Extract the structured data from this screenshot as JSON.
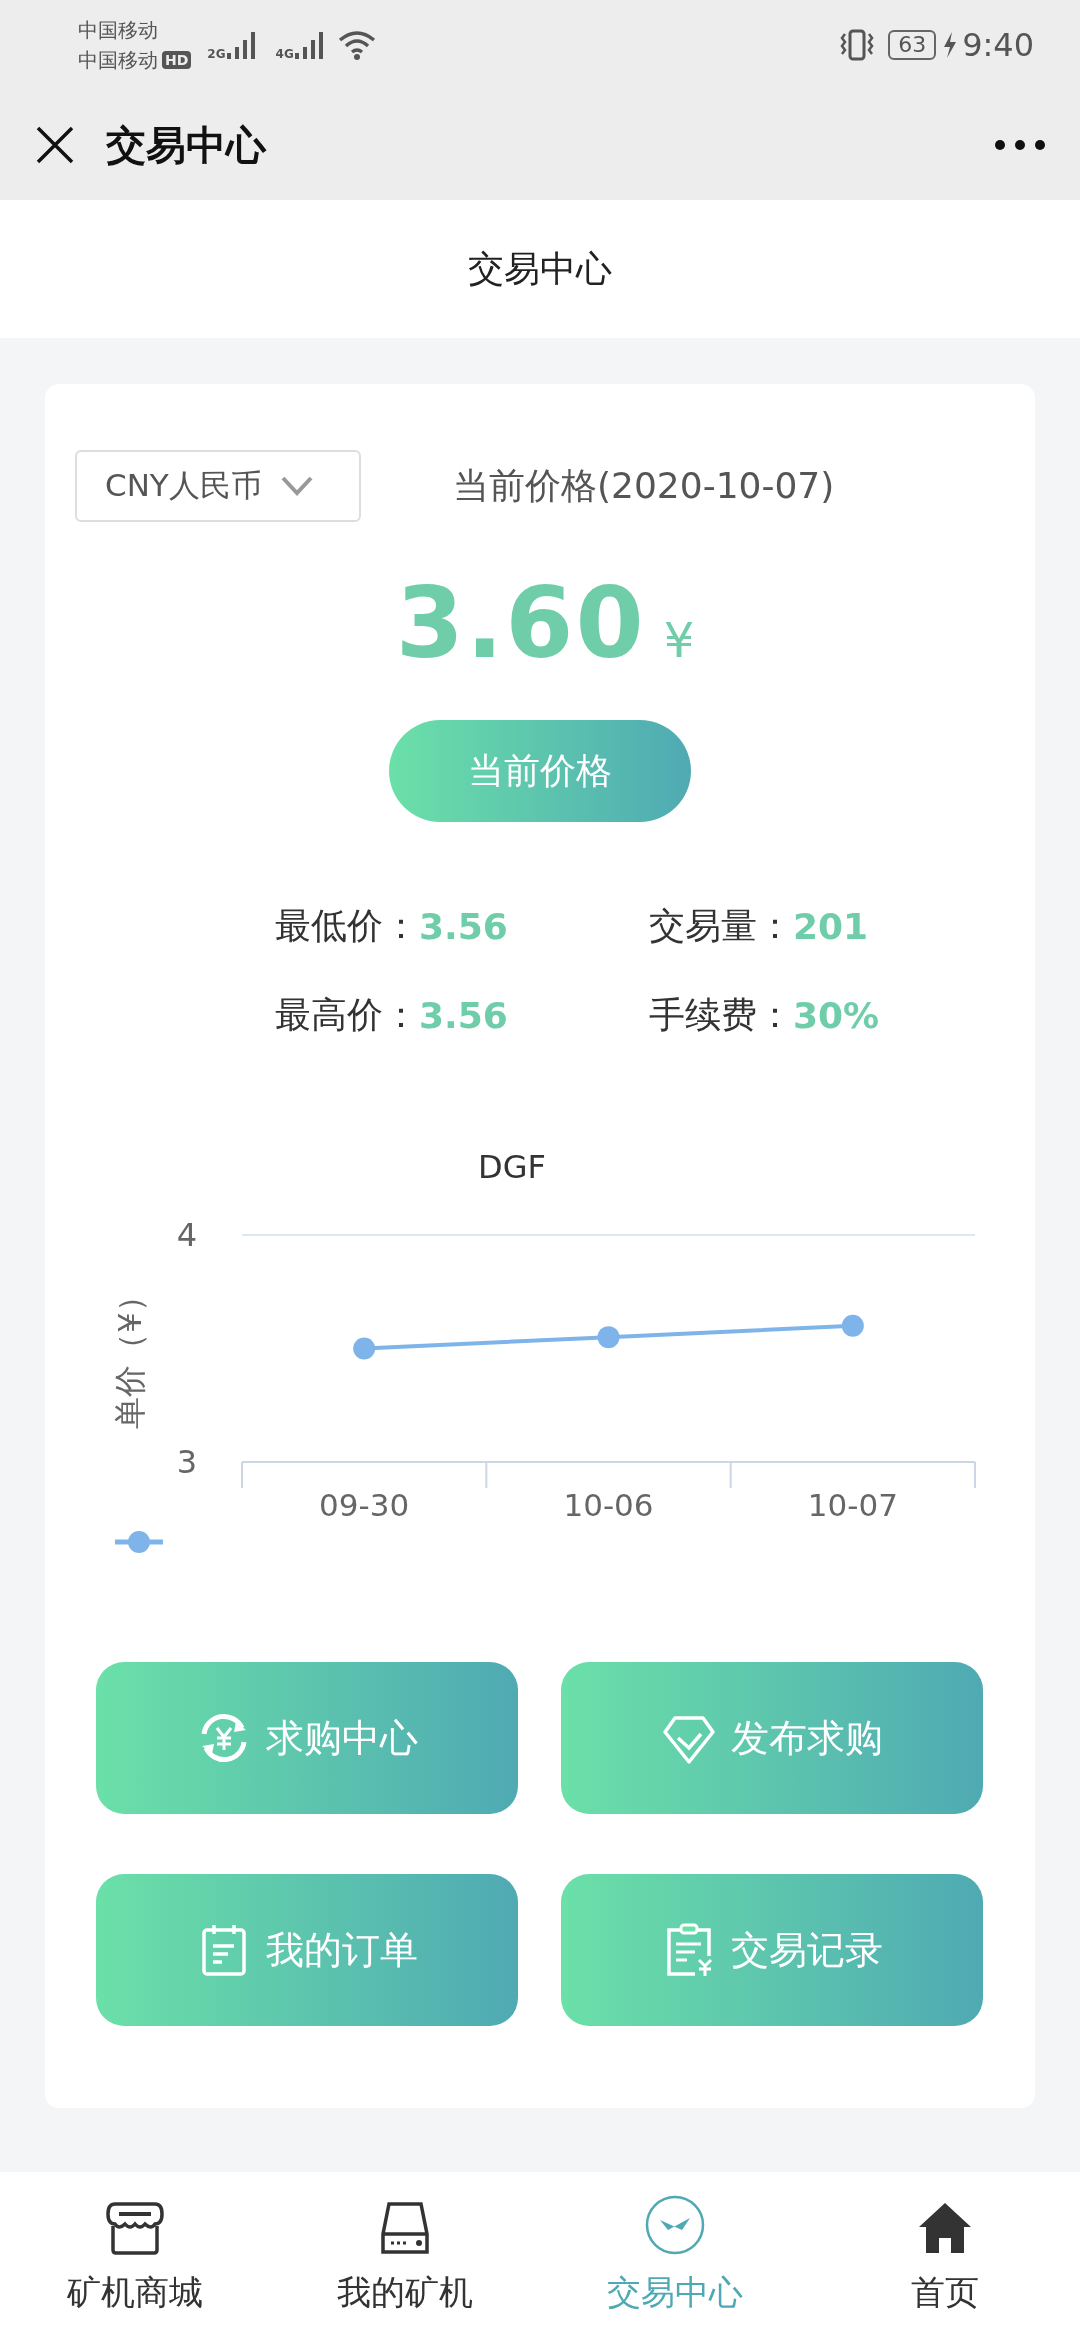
{
  "status_bar": {
    "carriers": [
      {
        "name": "中国移动"
      },
      {
        "name": "中国移动",
        "badge": "HD"
      }
    ],
    "networks": [
      "2G",
      "4G"
    ],
    "battery": "63",
    "time": "9:40"
  },
  "nav_bar": {
    "title": "交易中心"
  },
  "page_title": "交易中心",
  "currency_select": {
    "value": "CNY人民币"
  },
  "price_date": "当前价格(2020-10-07)",
  "price": {
    "value": "3.60",
    "unit": "¥"
  },
  "price_button": "当前价格",
  "stats": [
    {
      "label": "最低价：",
      "value": "3.56"
    },
    {
      "label": "交易量：",
      "value": "201"
    },
    {
      "label": "最高价：",
      "value": "3.56"
    },
    {
      "label": "手续费：",
      "value": "30%"
    }
  ],
  "chart_data": {
    "type": "line",
    "title": "DGF",
    "ylabel": "单价（¥）",
    "categories": [
      "09-30",
      "10-06",
      "10-07"
    ],
    "series": [
      {
        "color": "#7eb4ea",
        "marker": "circle",
        "values": [
          3.5,
          3.55,
          3.6
        ]
      }
    ],
    "ylim": [
      3,
      4
    ],
    "yticks": [
      3,
      4
    ]
  },
  "actions": [
    {
      "label": "求购中心"
    },
    {
      "label": "发布求购"
    },
    {
      "label": "我的订单"
    },
    {
      "label": "交易记录"
    }
  ],
  "tabs": [
    {
      "label": "矿机商城",
      "selected": false
    },
    {
      "label": "我的矿机",
      "selected": false
    },
    {
      "label": "交易中心",
      "selected": true
    },
    {
      "label": "首页",
      "selected": false
    }
  ]
}
